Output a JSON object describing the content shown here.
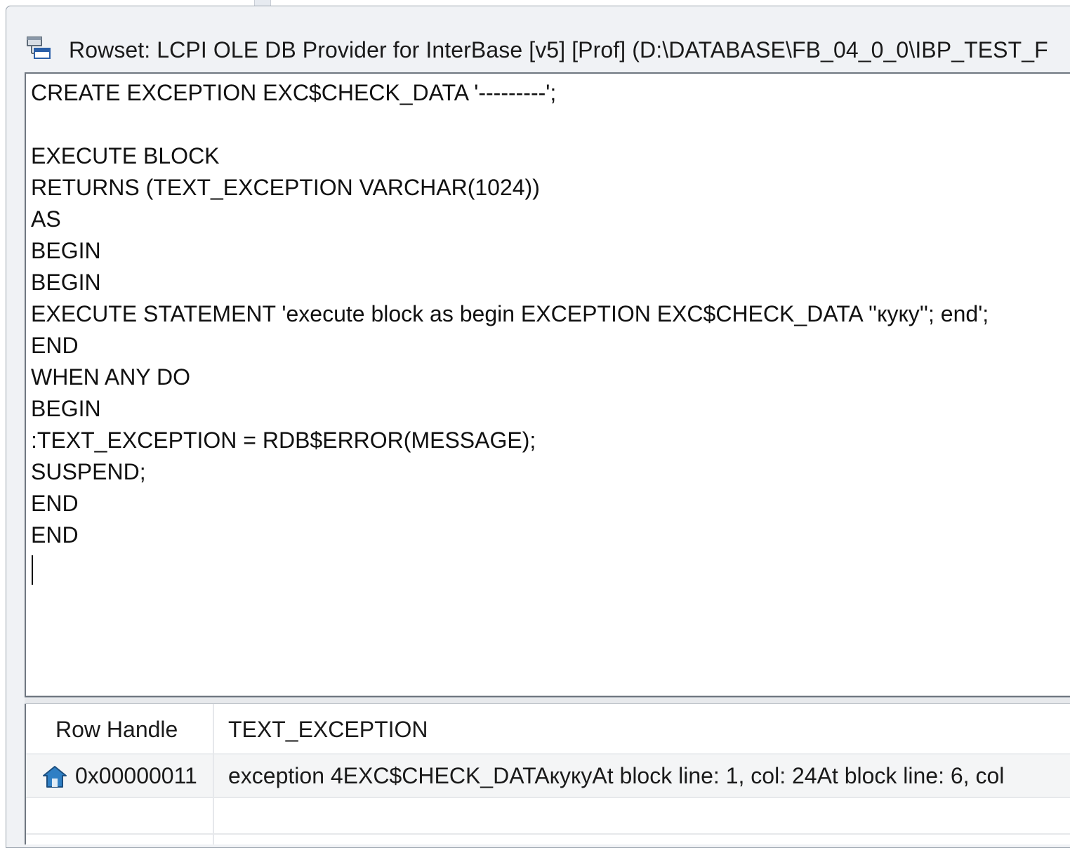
{
  "window": {
    "title": "Rowset: LCPI OLE DB Provider for InterBase [v5] [Prof] (D:\\DATABASE\\FB_04_0_0\\IBP_TEST_F"
  },
  "editor": {
    "lines": [
      "CREATE EXCEPTION EXC$CHECK_DATA '---------';",
      "",
      "EXECUTE BLOCK",
      "RETURNS (TEXT_EXCEPTION VARCHAR(1024))",
      "AS",
      "BEGIN",
      "BEGIN",
      "EXECUTE STATEMENT 'execute block as begin EXCEPTION EXC$CHECK_DATA ''куку''; end';",
      "END",
      "WHEN ANY DO",
      "BEGIN",
      ":TEXT_EXCEPTION = RDB$ERROR(MESSAGE);",
      "SUSPEND;",
      "END",
      "END"
    ]
  },
  "grid": {
    "columns": [
      "Row Handle",
      "TEXT_EXCEPTION"
    ],
    "rows": [
      {
        "handle": "0x00000011",
        "text_exception": "exception 4EXC$CHECK_DATAкукуAt block line: 1, col: 24At block line: 6, col"
      }
    ]
  },
  "icons": {
    "window_icon": "database-window-icon",
    "current_row_icon": "current-row-home-icon"
  },
  "colors": {
    "row_icon": "#2f7fc4",
    "window_bg": "#f0f2f5"
  }
}
